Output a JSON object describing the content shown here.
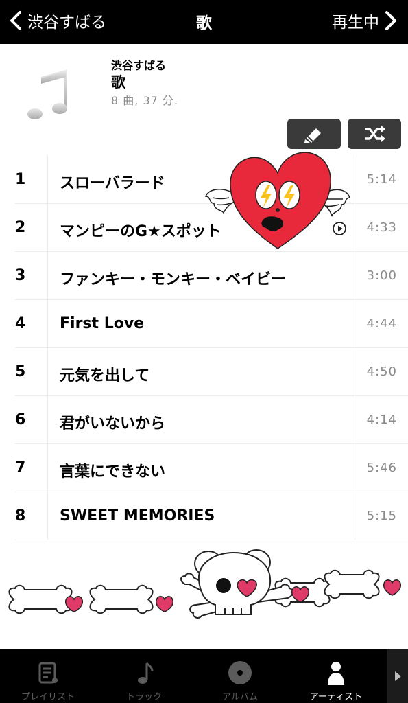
{
  "nav": {
    "back_label": "渋谷すばる",
    "title": "歌",
    "now_playing_label": "再生中"
  },
  "album": {
    "artist": "渋谷すばる",
    "title": "歌",
    "meta": "8 曲, 37 分."
  },
  "actions": {
    "edit_icon": "pencil-icon",
    "shuffle_icon": "shuffle-icon"
  },
  "tracks": [
    {
      "num": "1",
      "title": "スローバラード",
      "duration": "5:14"
    },
    {
      "num": "2",
      "title": "マンピーのG★スポット",
      "duration": "4:33"
    },
    {
      "num": "3",
      "title": "ファンキー・モンキー・ベイビー",
      "duration": "3:00"
    },
    {
      "num": "4",
      "title": "First Love",
      "duration": "4:44"
    },
    {
      "num": "5",
      "title": "元気を出して",
      "duration": "4:50"
    },
    {
      "num": "6",
      "title": "君がいないから",
      "duration": "4:14"
    },
    {
      "num": "7",
      "title": "言葉にできない",
      "duration": "5:46"
    },
    {
      "num": "8",
      "title": "SWEET MEMORIES",
      "duration": "5:15"
    }
  ],
  "tabs": [
    {
      "label": "プレイリスト",
      "icon": "playlist-icon"
    },
    {
      "label": "トラック",
      "icon": "music-note-icon"
    },
    {
      "label": "アルバム",
      "icon": "album-disc-icon"
    },
    {
      "label": "アーティスト",
      "icon": "artist-person-icon"
    }
  ],
  "colors": {
    "bar_background": "#000000",
    "button_background": "#3a3a3a",
    "secondary_text": "#8a8a8a",
    "sticker_heart": "#e8293b",
    "sticker_pink": "#e03a68"
  }
}
